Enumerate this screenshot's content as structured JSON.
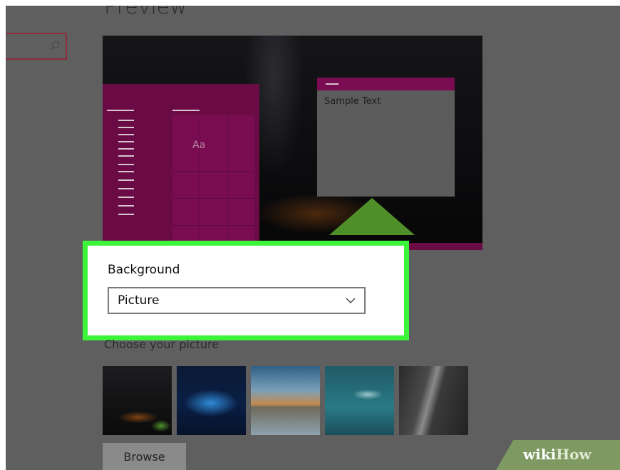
{
  "header": {
    "title": "Preview"
  },
  "search": {
    "placeholder": ""
  },
  "preview": {
    "sample_text": "Sample Text",
    "tile_text": "Aa"
  },
  "background": {
    "label": "Background",
    "selected": "Picture"
  },
  "pictures": {
    "label": "Choose your picture",
    "browse_label": "Browse"
  },
  "watermark": {
    "part1": "wiki",
    "part2": "How"
  },
  "colors": {
    "accent": "#6a0b45",
    "highlight": "#3cf53a"
  }
}
